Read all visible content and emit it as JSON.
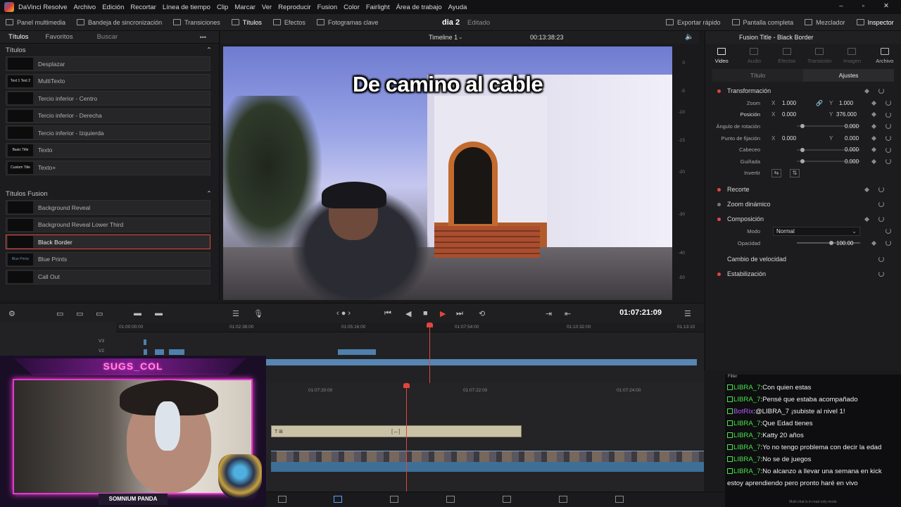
{
  "menubar": {
    "app": "DaVinci Resolve",
    "items": [
      "Archivo",
      "Edición",
      "Recortar",
      "Línea de tiempo",
      "Clip",
      "Marcar",
      "Ver",
      "Reproducir",
      "Fusion",
      "Color",
      "Fairlight",
      "Área de trabajo",
      "Ayuda"
    ]
  },
  "toolbar": {
    "media_pool": "Panel multimedia",
    "sync_bin": "Bandeja de sincronización",
    "transitions": "Transiciones",
    "titles": "Títulos",
    "effects": "Efectos",
    "keyframes": "Fotogramas clave",
    "project": "dia 2",
    "project_status": "Editado",
    "quick_export": "Exportar rápido",
    "fullscreen": "Pantalla completa",
    "mixer": "Mezclador",
    "inspector": "Inspector"
  },
  "left": {
    "tab_titles": "Títulos",
    "tab_favorites": "Favoritos",
    "search_placeholder": "Buscar",
    "section_titles": "Títulos",
    "titles": [
      {
        "thumb": "",
        "label": "Desplazar"
      },
      {
        "thumb": "Text 1 Text 2",
        "label": "MultiTexto"
      },
      {
        "thumb": "",
        "label": "Tercio inferior - Centro"
      },
      {
        "thumb": "",
        "label": "Tercio inferior - Derecha"
      },
      {
        "thumb": "",
        "label": "Tercio inferior - Izquierda"
      },
      {
        "thumb": "Basic Title",
        "label": "Texto"
      },
      {
        "thumb": "Custom Title",
        "label": "Texto+"
      }
    ],
    "section_fusion": "Títulos Fusion",
    "fusion": [
      {
        "thumb": "",
        "label": "Background Reveal"
      },
      {
        "thumb": "",
        "label": "Background Reveal Lower Third"
      },
      {
        "thumb": "",
        "label": "Black Border"
      },
      {
        "thumb": "Blue Prints",
        "label": "Blue Prints"
      },
      {
        "thumb": "",
        "label": "Call Out"
      }
    ]
  },
  "viewer": {
    "timeline_name": "Timeline 1",
    "timecode_top": "00:13:38:23",
    "caption": "De camino al cable",
    "scale": [
      "0",
      "-5",
      "-10",
      "-15",
      "-20",
      "-30",
      "-40",
      "-50"
    ]
  },
  "inspector": {
    "title": "Fusion Title - Black Border",
    "tabs": [
      {
        "label": "Video",
        "on": true
      },
      {
        "label": "Audio",
        "on": false
      },
      {
        "label": "Efectos",
        "on": false
      },
      {
        "label": "Transición",
        "on": false
      },
      {
        "label": "Imagen",
        "on": false
      },
      {
        "label": "Archivo",
        "on": false
      }
    ],
    "sub_title": "Título",
    "sub_settings": "Ajustes",
    "transform": "Transformación",
    "zoom": "Zoom",
    "zoom_x": "1.000",
    "zoom_y": "1.000",
    "position": "Posición",
    "pos_x": "0.000",
    "pos_y": "376.000",
    "rotation": "Ángulo de rotación",
    "rotation_val": "0.000",
    "anchor": "Punto de fijación",
    "anchor_x": "0.000",
    "anchor_y": "0.000",
    "pitch": "Cabeceo",
    "pitch_val": "0.000",
    "yaw": "Guiñada",
    "yaw_val": "0.000",
    "flip": "Invertir",
    "crop": "Recorte",
    "dynamic_zoom": "Zoom dinámico",
    "composite": "Composición",
    "mode": "Modo",
    "mode_val": "Normal",
    "opacity": "Opacidad",
    "opacity_val": "100.00",
    "speed": "Cambio de velocidad",
    "stabilization": "Estabilización",
    "x": "X",
    "y": "Y"
  },
  "transport": {
    "timecode": "01:07:21:09"
  },
  "timeline": {
    "ruler": [
      "01:00:00:00",
      "01:02:38:00",
      "01:05:16:00",
      "01:07:54:00",
      "01:10:32:00",
      "01:13:10"
    ],
    "tracks": [
      "V3",
      "V2"
    ],
    "ruler2": [
      "01:07:20:00",
      "01:07:22:00",
      "01:07:24:00"
    ]
  },
  "stream": {
    "channel": "SUGS_COL",
    "footer": "SOMNIUM PANDA"
  },
  "chat": {
    "header": "Filter",
    "messages": [
      {
        "user": "LIBRA_7",
        "text": "Con quien estas",
        "kind": "u"
      },
      {
        "user": "LIBRA_7",
        "text": "Pensé que estaba acompañado",
        "kind": "u"
      },
      {
        "user": "BotRix",
        "text": "@LIBRA_7 ¡subiste al nivel 1!",
        "kind": "uk"
      },
      {
        "user": "LIBRA_7",
        "text": "Que Edad tienes",
        "kind": "u"
      },
      {
        "user": "LIBRA_7",
        "text": "Katty 20 años",
        "kind": "u"
      },
      {
        "user": "LIBRA_7",
        "text": "Yo no tengo problema con decir la edad",
        "kind": "u"
      },
      {
        "user": "LIBRA_7",
        "text": "No se de juegos",
        "kind": "u"
      },
      {
        "user": "LIBRA_7",
        "text": "No alcanzo a llevar una semana en kick",
        "kind": "u"
      }
    ],
    "continuation": "estoy aprendiendo pero pronto haré en vivo",
    "note": "Multi chat is in read only mode"
  },
  "colors": {
    "accent_red": "#e2463e",
    "clip_blue": "#4f80ad",
    "chat_green": "#4be24b"
  }
}
